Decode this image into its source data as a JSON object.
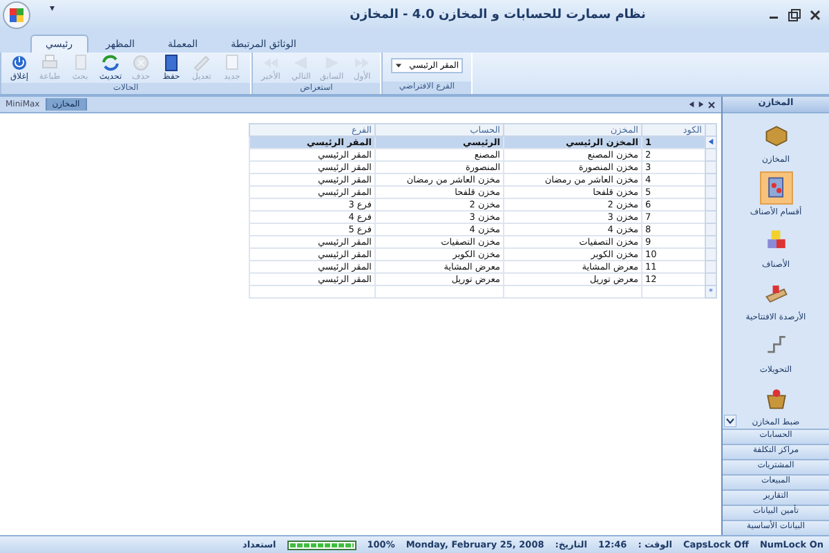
{
  "window": {
    "title": "نظام سمارت للحسابات و المخازن 4.0 - المخازن",
    "quick_access": "▾"
  },
  "ribbon_tabs": [
    {
      "label": "الوثائق المرتبطة",
      "selected": false
    },
    {
      "label": "المعملة",
      "selected": false
    },
    {
      "label": "المظهر",
      "selected": false
    },
    {
      "label": "رئيسي",
      "selected": true
    }
  ],
  "ribbon_groups": [
    {
      "kind": "select",
      "title": "الفرع الافتراضي",
      "value": "المقر الرئيسي"
    },
    {
      "kind": "buttons",
      "title": "استعراض",
      "buttons": [
        {
          "label": "الأول",
          "disabled": true
        },
        {
          "label": "السابق",
          "disabled": true
        },
        {
          "label": "التالي",
          "disabled": true
        },
        {
          "label": "الأخير",
          "disabled": true
        }
      ]
    },
    {
      "kind": "buttons",
      "title": "الحالات",
      "buttons": [
        {
          "label": "جديد",
          "disabled": true
        },
        {
          "label": "تعديل",
          "disabled": true
        },
        {
          "label": "حفظ",
          "disabled": false
        },
        {
          "label": "حذف",
          "disabled": true
        },
        {
          "label": "تحديث",
          "disabled": false
        },
        {
          "label": "بحث",
          "disabled": true
        },
        {
          "label": "طباعة",
          "disabled": true
        },
        {
          "label": "إغلاق",
          "disabled": false
        }
      ]
    }
  ],
  "document_tabs": [
    {
      "label": "المخازن",
      "selected": true
    },
    {
      "label": "MiniMax",
      "selected": false
    }
  ],
  "table": {
    "columns": [
      "الكود",
      "المخزن",
      "الحساب",
      "الفرع"
    ],
    "rows": [
      {
        "cells": [
          "1",
          "المخزن الرئيسي",
          "الرئيسي",
          "المقر الرئيسي"
        ],
        "selected": true
      },
      {
        "cells": [
          "2",
          "مخزن المصنع",
          "المصنع",
          "المقر الرئيسي"
        ],
        "selected": false
      },
      {
        "cells": [
          "3",
          "مخزن المنصورة",
          "المنصورة",
          "المقر الرئيسي"
        ],
        "selected": false
      },
      {
        "cells": [
          "4",
          "مخزن العاشر من رمضان",
          "مخزن العاشر من رمضان",
          "المقر الرئيسي"
        ],
        "selected": false
      },
      {
        "cells": [
          "5",
          "مخزن قلفحا",
          "مخزن قلفحا",
          "المقر الرئيسي"
        ],
        "selected": false
      },
      {
        "cells": [
          "6",
          "مخزن 2",
          "مخزن 2",
          "فرع 3"
        ],
        "selected": false
      },
      {
        "cells": [
          "7",
          "مخزن 3",
          "مخزن 3",
          "فرع 4"
        ],
        "selected": false
      },
      {
        "cells": [
          "8",
          "مخزن 4",
          "مخزن 4",
          "فرع 5"
        ],
        "selected": false
      },
      {
        "cells": [
          "9",
          "مخزن التصفيات",
          "مخزن التصفيات",
          "المقر الرئيسي"
        ],
        "selected": false
      },
      {
        "cells": [
          "10",
          "مخزن الكوبر",
          "مخزن الكوبر",
          "المقر الرئيسي"
        ],
        "selected": false
      },
      {
        "cells": [
          "11",
          "معرض المشاية",
          "معرض المشاية",
          "المقر الرئيسي"
        ],
        "selected": false
      },
      {
        "cells": [
          "12",
          "معرض توريل",
          "معرض توريل",
          "المقر الرئيسي"
        ],
        "selected": false
      }
    ],
    "new_row_marker": "*"
  },
  "side_panel": {
    "title": "المخازن",
    "items": [
      {
        "label": "المخازن",
        "selected": false
      },
      {
        "label": "أقسام الأصناف",
        "selected": true
      },
      {
        "label": "الأصناف",
        "selected": false
      },
      {
        "label": "الأرصدة الافتتاحية",
        "selected": false
      },
      {
        "label": "التحويلات",
        "selected": false
      },
      {
        "label": "ضبط المخازن",
        "selected": false
      }
    ],
    "sections": [
      "الحسابات",
      "مراكز التكلفة",
      "المشتريات",
      "المبيعات",
      "التقارير",
      "تأمين البيانات",
      "البيانات الأساسية"
    ]
  },
  "status_bar": {
    "num_lock": "NumLock On",
    "caps_lock": "CapsLock Off",
    "time_label": "الوقت :",
    "time": "12:46",
    "date_label": "التاريخ:",
    "date": "Monday, February 25, 2008",
    "zoom": "100%",
    "progress": {
      "level": 1
    },
    "status": "استعداد"
  }
}
